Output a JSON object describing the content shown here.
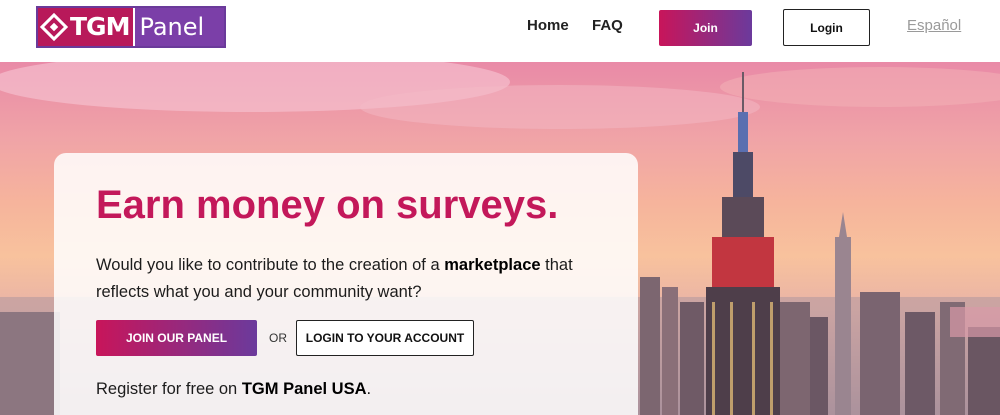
{
  "header": {
    "logo_text_tgm": "TGM",
    "logo_text_panel": "Panel",
    "nav": [
      {
        "label": "Home"
      },
      {
        "label": "FAQ"
      }
    ],
    "join_label": "Join",
    "login_label": "Login",
    "language_label": "Español"
  },
  "hero": {
    "headline": "Earn money on surveys.",
    "intro_part1": "Would you like to contribute to the creation of a ",
    "intro_bold": "marketplace",
    "intro_part2": " that reflects what you and your community want?",
    "join_panel_label": "JOIN OUR PANEL",
    "or_label": "OR",
    "login_account_label": "LOGIN TO YOUR ACCOUNT",
    "register_prefix": "Register for free on ",
    "register_bold": "TGM Panel USA",
    "register_suffix": "."
  },
  "colors": {
    "accent": "#c3185a",
    "gradient_start": "#c8155a",
    "gradient_end": "#6b3a9c"
  }
}
